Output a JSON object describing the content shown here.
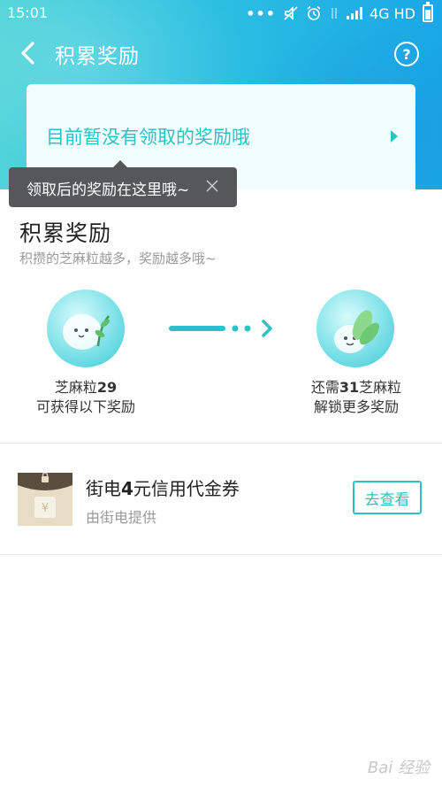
{
  "status_bar": {
    "time": "15:01",
    "dots": "•••",
    "network": "4G HD"
  },
  "nav": {
    "title": "积累奖励",
    "help_icon": "question-circle-icon",
    "back_icon": "chevron-left-icon"
  },
  "reward_card": {
    "text": "目前暂没有领取的奖励哦"
  },
  "tooltip": {
    "text": "领取后的奖励在这里哦~"
  },
  "section": {
    "title": "积累奖励",
    "subtitle": "积攒的芝麻粒越多，奖励越多哦~"
  },
  "progress": {
    "left_line1_prefix": "芝麻粒",
    "left_count": "29",
    "left_line2": "可获得以下奖励",
    "right_line1_prefix": "还需",
    "right_count": "31",
    "right_line1_suffix": "芝麻粒",
    "right_line2": "解锁更多奖励"
  },
  "coupon": {
    "title_prefix": "街电",
    "title_amount": "4",
    "title_suffix": "元信用代金券",
    "provider": "由街电提供",
    "button_label": "去查看",
    "icon": "coupon-envelope-icon"
  },
  "watermark": {
    "text": "Bai 经验"
  },
  "colors": {
    "accent": "#2cc1c6",
    "header_start": "#4fd4d9",
    "header_end": "#1aa7e6",
    "tooltip_bg": "#555759"
  }
}
